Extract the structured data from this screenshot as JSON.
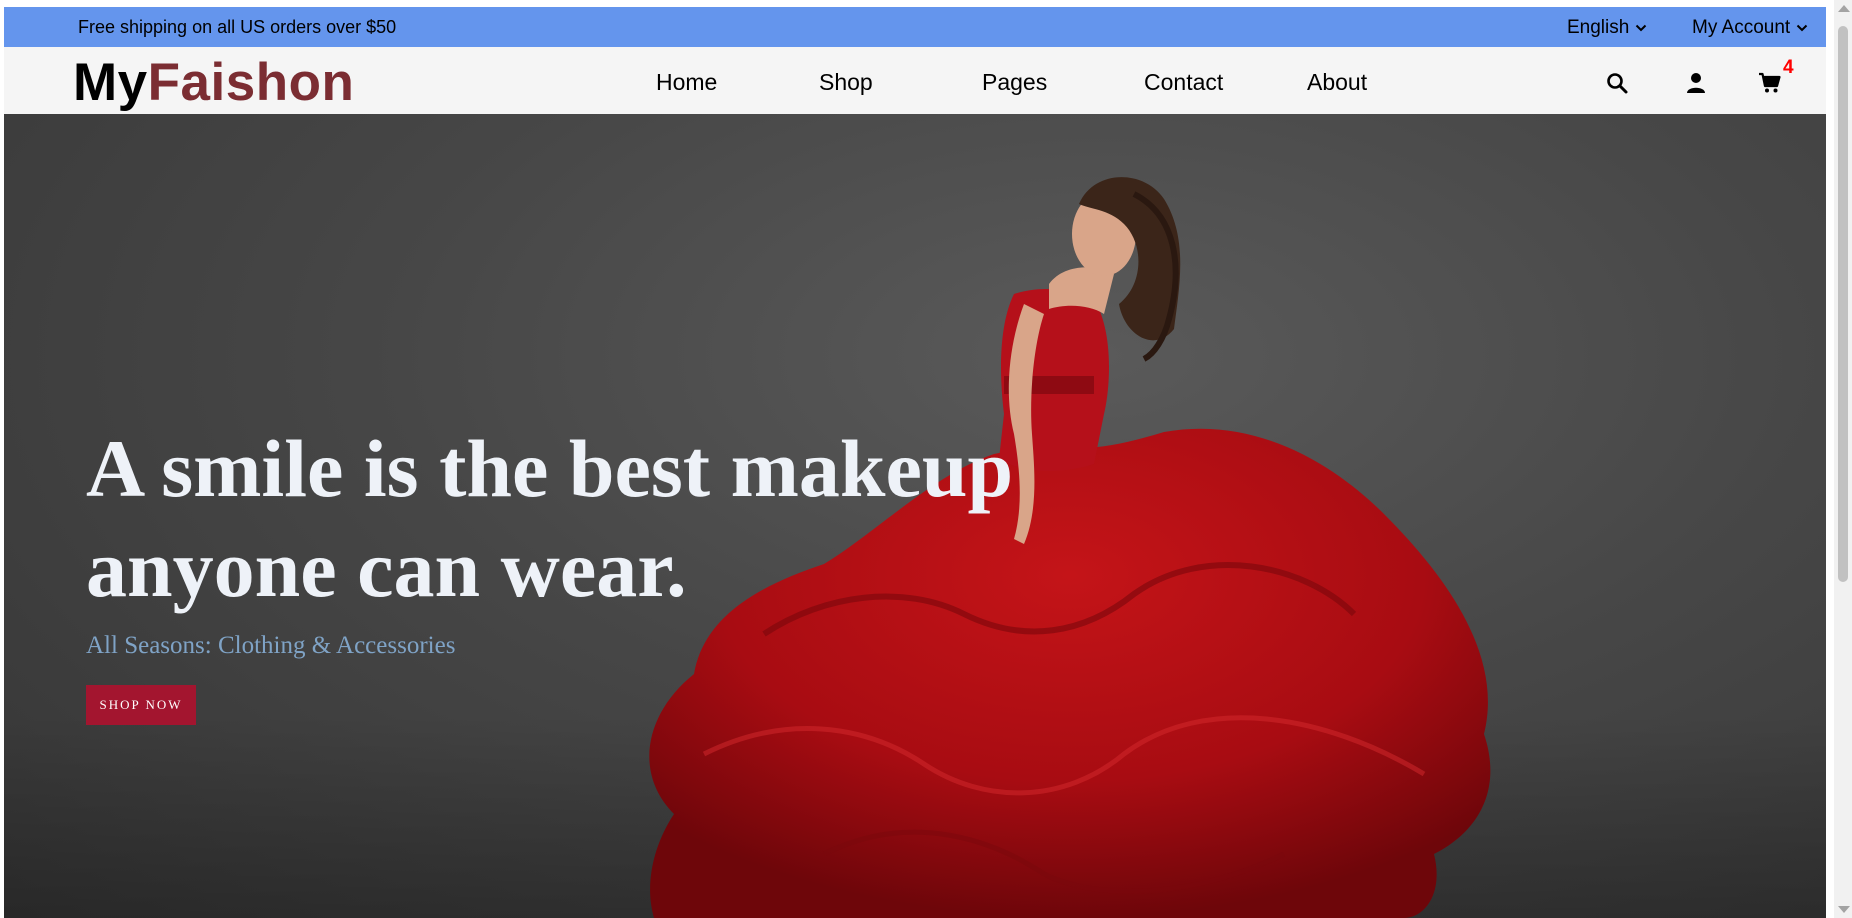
{
  "topbar": {
    "shipping_text": "Free shipping on all US orders over $50",
    "language_label": "English",
    "account_label": "My Account",
    "bg_color": "#6495ed"
  },
  "header": {
    "logo_part1": "My",
    "logo_part2": "Faishon",
    "logo_accent_color": "#7b2d32",
    "nav": [
      "Home",
      "Shop",
      "Pages",
      "Contact",
      "About"
    ],
    "icons": [
      "search-icon",
      "user-icon",
      "cart-icon"
    ],
    "cart_count": "4"
  },
  "hero": {
    "headline_line1": "A smile is the best makeup",
    "headline_line2": "anyone can wear.",
    "subtitle": "All Seasons: Clothing & Accessories",
    "cta_label": "SHOP NOW",
    "cta_color": "#a3152f"
  }
}
